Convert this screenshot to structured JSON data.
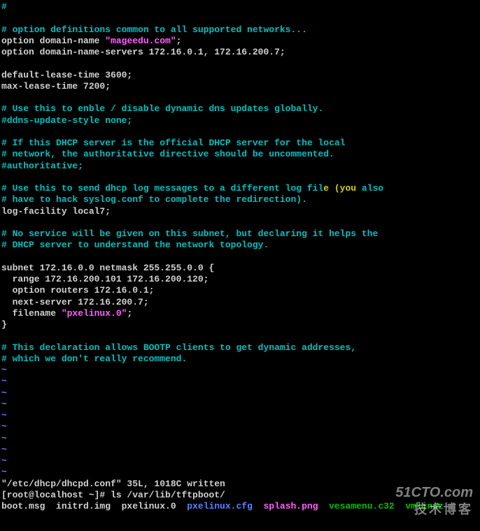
{
  "lines": [
    {
      "segments": [
        {
          "cls": "cyan",
          "text": "#"
        }
      ]
    },
    {
      "segments": [
        {
          "cls": "white",
          "text": " "
        }
      ]
    },
    {
      "segments": [
        {
          "cls": "cyan",
          "text": "# option definitions common to all supported networks..."
        }
      ]
    },
    {
      "segments": [
        {
          "cls": "white",
          "text": "option domain-name "
        },
        {
          "cls": "magenta",
          "text": "\"mageedu.com\""
        },
        {
          "cls": "white",
          "text": ";"
        }
      ]
    },
    {
      "segments": [
        {
          "cls": "white",
          "text": "option domain-name-servers 172.16.0.1, 172.16.200.7;"
        }
      ]
    },
    {
      "segments": [
        {
          "cls": "white",
          "text": " "
        }
      ]
    },
    {
      "segments": [
        {
          "cls": "white",
          "text": "default-lease-time 3600;"
        }
      ]
    },
    {
      "segments": [
        {
          "cls": "white",
          "text": "max-lease-time 7200;"
        }
      ]
    },
    {
      "segments": [
        {
          "cls": "white",
          "text": " "
        }
      ]
    },
    {
      "segments": [
        {
          "cls": "cyan",
          "text": "# Use this to enble / disable dynamic dns updates globally."
        }
      ]
    },
    {
      "segments": [
        {
          "cls": "cyan",
          "text": "#ddns-update-style none;"
        }
      ]
    },
    {
      "segments": [
        {
          "cls": "white",
          "text": " "
        }
      ]
    },
    {
      "segments": [
        {
          "cls": "cyan",
          "text": "# If this DHCP server is the official DHCP server for the local"
        }
      ]
    },
    {
      "segments": [
        {
          "cls": "cyan",
          "text": "# network, the authoritative directive should be uncommented."
        }
      ]
    },
    {
      "segments": [
        {
          "cls": "cyan",
          "text": "#authoritative;"
        }
      ]
    },
    {
      "segments": [
        {
          "cls": "white",
          "text": " "
        }
      ]
    },
    {
      "segments": [
        {
          "cls": "cyan",
          "text": "# Use this to send dhcp log messages to a different log fil"
        },
        {
          "cls": "yellow",
          "text": "e (you"
        },
        {
          "cls": "cyan",
          "text": " also"
        }
      ]
    },
    {
      "segments": [
        {
          "cls": "cyan",
          "text": "# have to hack syslog.conf to complete the redirection)."
        }
      ]
    },
    {
      "segments": [
        {
          "cls": "white",
          "text": "log-facility local7;"
        }
      ]
    },
    {
      "segments": [
        {
          "cls": "white",
          "text": " "
        }
      ]
    },
    {
      "segments": [
        {
          "cls": "cyan",
          "text": "# No service will be given on this subnet, but declaring it helps the"
        }
      ]
    },
    {
      "segments": [
        {
          "cls": "cyan",
          "text": "# DHCP server to understand the network topology."
        }
      ]
    },
    {
      "segments": [
        {
          "cls": "white",
          "text": " "
        }
      ]
    },
    {
      "segments": [
        {
          "cls": "white",
          "text": "subnet 172.16.0.0 netmask 255.255.0.0 {"
        }
      ]
    },
    {
      "segments": [
        {
          "cls": "white",
          "text": "  range 172.16.200.101 172.16.200.120;"
        }
      ]
    },
    {
      "segments": [
        {
          "cls": "white",
          "text": "  option routers 172.16.0.1;"
        }
      ]
    },
    {
      "segments": [
        {
          "cls": "white",
          "text": "  next-server 172.16.200.7;"
        }
      ]
    },
    {
      "segments": [
        {
          "cls": "white",
          "text": "  filename "
        },
        {
          "cls": "magenta",
          "text": "\"pxelinux.0\""
        },
        {
          "cls": "white",
          "text": ";"
        }
      ]
    },
    {
      "segments": [
        {
          "cls": "white",
          "text": "}"
        }
      ]
    },
    {
      "segments": [
        {
          "cls": "white",
          "text": " "
        }
      ]
    },
    {
      "segments": [
        {
          "cls": "cyan",
          "text": "# This declaration allows BOOTP clients to get dynamic addresses,"
        }
      ]
    },
    {
      "segments": [
        {
          "cls": "cyan",
          "text": "# which we don't really recommend."
        }
      ]
    },
    {
      "segments": [
        {
          "cls": "lightblue",
          "text": "~"
        }
      ]
    },
    {
      "segments": [
        {
          "cls": "lightblue",
          "text": "~"
        }
      ]
    },
    {
      "segments": [
        {
          "cls": "lightblue",
          "text": "~"
        }
      ]
    },
    {
      "segments": [
        {
          "cls": "lightblue",
          "text": "~"
        }
      ]
    },
    {
      "segments": [
        {
          "cls": "lightblue",
          "text": "~"
        }
      ]
    },
    {
      "segments": [
        {
          "cls": "lightblue",
          "text": "~"
        }
      ]
    },
    {
      "segments": [
        {
          "cls": "lightblue",
          "text": "~"
        }
      ]
    },
    {
      "segments": [
        {
          "cls": "lightblue",
          "text": "~"
        }
      ]
    },
    {
      "segments": [
        {
          "cls": "lightblue",
          "text": "~"
        }
      ]
    },
    {
      "segments": [
        {
          "cls": "lightblue",
          "text": "~"
        }
      ]
    },
    {
      "segments": [
        {
          "cls": "white",
          "text": "\"/etc/dhcp/dhcpd.conf\" 35L, 1018C written"
        }
      ]
    },
    {
      "segments": [
        {
          "cls": "white",
          "text": "[root@localhost ~]# "
        },
        {
          "cls": "white",
          "text": "ls /var/lib/tftpboot/"
        }
      ]
    },
    {
      "segments": [
        {
          "cls": "white",
          "text": "boot.msg  initrd.img  pxelinux.0  "
        },
        {
          "cls": "lightblue",
          "text": "pxelinux.cfg"
        },
        {
          "cls": "white",
          "text": "  "
        },
        {
          "cls": "magenta",
          "text": "splash.png"
        },
        {
          "cls": "white",
          "text": "  "
        },
        {
          "cls": "green",
          "text": "vesamenu.c32"
        },
        {
          "cls": "white",
          "text": "  "
        },
        {
          "cls": "green",
          "text": "vmlinuz"
        }
      ]
    }
  ],
  "watermark": {
    "logo": "51CTO.com",
    "sub": "技术博客"
  }
}
